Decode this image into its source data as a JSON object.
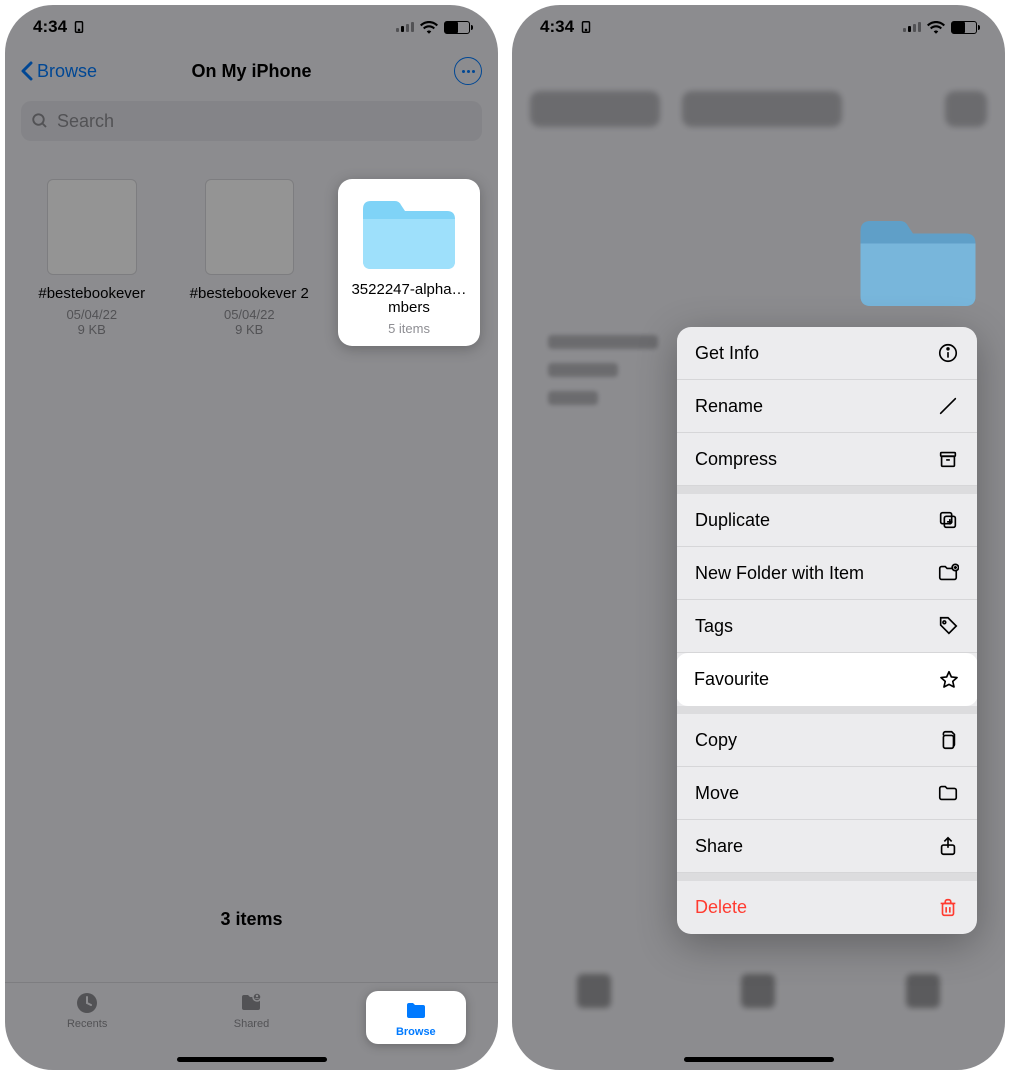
{
  "status": {
    "time": "4:34"
  },
  "nav": {
    "back": "Browse",
    "title": "On My iPhone"
  },
  "search": {
    "placeholder": "Search"
  },
  "files": [
    {
      "name": "#bestebookever",
      "date": "05/04/22",
      "size": "9 KB"
    },
    {
      "name": "#bestebookever 2",
      "date": "05/04/22",
      "size": "9 KB"
    },
    {
      "name": "3522247-alpha…mbers",
      "subtitle": "5 items"
    }
  ],
  "footer": {
    "count": "3 items"
  },
  "tabs": {
    "recents": "Recents",
    "shared": "Shared",
    "browse": "Browse"
  },
  "menu": {
    "get_info": "Get Info",
    "rename": "Rename",
    "compress": "Compress",
    "duplicate": "Duplicate",
    "new_folder": "New Folder with Item",
    "tags": "Tags",
    "favourite": "Favourite",
    "copy": "Copy",
    "move": "Move",
    "share": "Share",
    "delete": "Delete"
  }
}
